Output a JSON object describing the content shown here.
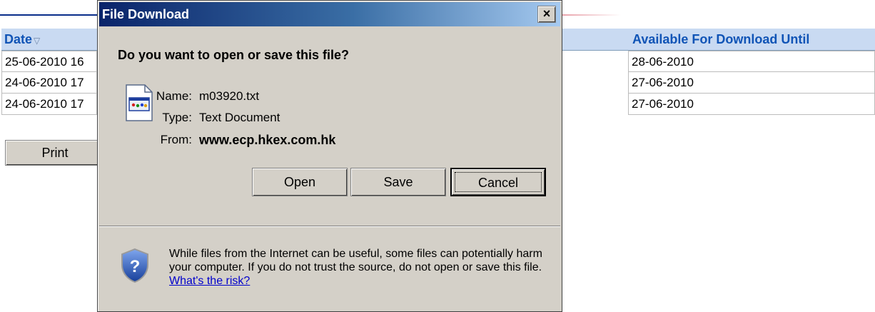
{
  "page": {
    "table": {
      "header_date": "Date",
      "sort_icon": "sort-down-triangle",
      "header_available": "Available For Download Until",
      "rows": [
        {
          "date": "25-06-2010 16",
          "available": "28-06-2010"
        },
        {
          "date": "24-06-2010 17",
          "available": "27-06-2010"
        },
        {
          "date": "24-06-2010 17",
          "available": "27-06-2010"
        }
      ]
    },
    "print_label": "Print"
  },
  "dialog": {
    "title": "File Download",
    "close_glyph": "×",
    "question": "Do you want to open or save this file?",
    "file": {
      "name_label": "Name:",
      "name_value": "m03920.txt",
      "type_label": "Type:",
      "type_value": "Text Document",
      "from_label": "From:",
      "from_value": "www.ecp.hkex.com.hk"
    },
    "buttons": {
      "open": "Open",
      "save": "Save",
      "cancel": "Cancel"
    },
    "warning_text": "While files from the Internet can be useful, some files can potentially harm your computer. If you do not trust the source, do not open or save this file.",
    "risk_link": "What's the risk?"
  },
  "colors": {
    "dialog_bg": "#d4d0c8",
    "titlebar_start": "#0a246a",
    "header_text": "#1054b6",
    "header_bg": "#c9daf2"
  }
}
